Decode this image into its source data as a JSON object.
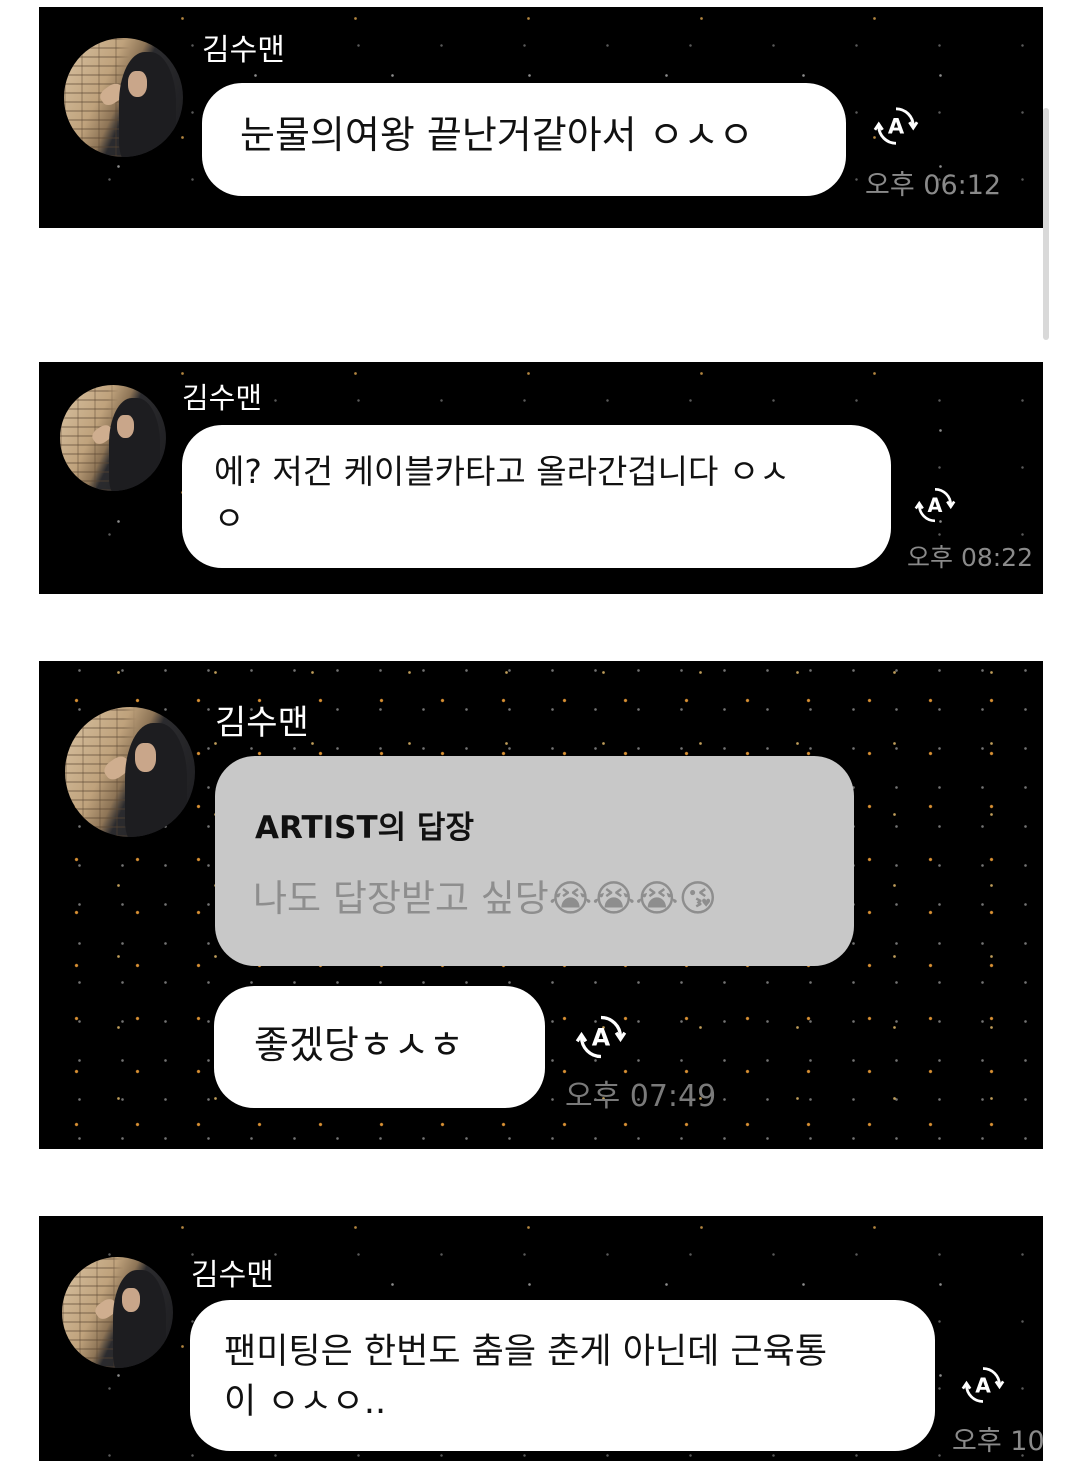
{
  "messages": [
    {
      "sender": "김수맨",
      "text": "눈물의여왕 끝난거같아서 ㅇㅅㅇ",
      "time": "오후 06:12",
      "translate_icon": "auto-translate-icon"
    },
    {
      "sender": "김수맨",
      "text_line1": "에? 저건 케이블카타고 올라간겁니다 ㅇㅅ",
      "text_line2": "ㅇ",
      "time": "오후 08:22",
      "translate_icon": "auto-translate-icon"
    },
    {
      "sender": "김수맨",
      "reply_to": {
        "title": "ARTIST의 답장",
        "text": "나도 답장받고 싶당😭😭😭😘"
      },
      "text": "좋겠당ㅎㅅㅎ",
      "time": "오후 07:49",
      "translate_icon": "auto-translate-icon"
    },
    {
      "sender": "김수맨",
      "text_line1": "팬미팅은 한번도 춤을 춘게 아닌데 근육통",
      "text_line2": "이 ㅇㅅㅇ..",
      "time": "오후 10",
      "translate_icon": "auto-translate-icon"
    }
  ],
  "colors": {
    "panel_bg": "#000000",
    "bubble_bg": "#ffffff",
    "reply_bg": "#c8c8c8",
    "time_text": "#8a8a8a",
    "sender_text": "#ffffff"
  }
}
